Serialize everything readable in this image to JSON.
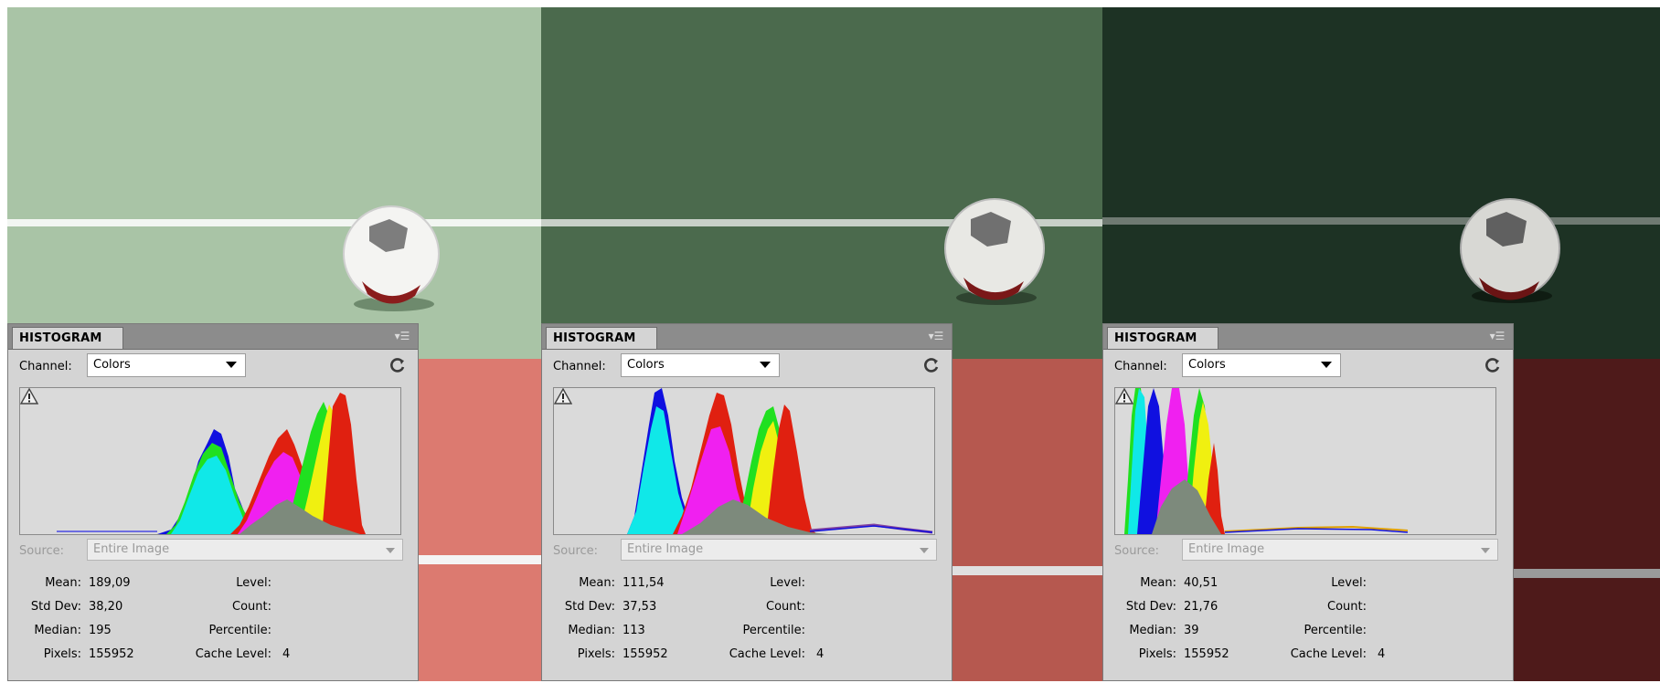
{
  "panels": [
    {
      "tab_label": "HISTOGRAM",
      "channel_label": "Channel:",
      "channel_value": "Colors",
      "source_label": "Source:",
      "source_value": "Entire Image",
      "mean_label": "Mean:",
      "mean_value": "189,09",
      "stddev_label": "Std Dev:",
      "stddev_value": "38,20",
      "median_label": "Median:",
      "median_value": "195",
      "pixels_label": "Pixels:",
      "pixels_value": "155952",
      "level_label": "Level:",
      "count_label": "Count:",
      "percentile_label": "Percentile:",
      "cache_label": "Cache Level:",
      "cache_value": "4"
    },
    {
      "tab_label": "HISTOGRAM",
      "channel_label": "Channel:",
      "channel_value": "Colors",
      "source_label": "Source:",
      "source_value": "Entire Image",
      "mean_label": "Mean:",
      "mean_value": "111,54",
      "stddev_label": "Std Dev:",
      "stddev_value": "37,53",
      "median_label": "Median:",
      "median_value": "113",
      "pixels_label": "Pixels:",
      "pixels_value": "155952",
      "level_label": "Level:",
      "count_label": "Count:",
      "percentile_label": "Percentile:",
      "cache_label": "Cache Level:",
      "cache_value": "4"
    },
    {
      "tab_label": "HISTOGRAM",
      "channel_label": "Channel:",
      "channel_value": "Colors",
      "source_label": "Source:",
      "source_value": "Entire Image",
      "mean_label": "Mean:",
      "mean_value": "40,51",
      "stddev_label": "Std Dev:",
      "stddev_value": "21,76",
      "median_label": "Median:",
      "median_value": "39",
      "pixels_label": "Pixels:",
      "pixels_value": "155952",
      "level_label": "Level:",
      "count_label": "Count:",
      "percentile_label": "Percentile:",
      "cache_label": "Cache Level:",
      "cache_value": "4"
    }
  ],
  "photos": [
    {
      "grass": "#a9c4a6",
      "track": "#dc7a70",
      "ball_tone": "#f4f4f2"
    },
    {
      "grass": "#4b6a4d",
      "track": "#b6584f",
      "ball_tone": "#e8e8e4"
    },
    {
      "grass": "#1d3224",
      "track": "#4e1a1a",
      "ball_tone": "#d8d8d4"
    }
  ],
  "histogram_colors": {
    "red": "#e02010",
    "green": "#20e020",
    "blue": "#1010e0",
    "cyan": "#10e8e8",
    "magenta": "#f020f0",
    "yellow": "#f0f010",
    "overlap": "#7d8a7c"
  },
  "icons": {
    "refresh": "refresh-icon",
    "warning": "warning-icon",
    "menu": "panel-menu-icon",
    "dropdown": "chevron-down-icon"
  }
}
